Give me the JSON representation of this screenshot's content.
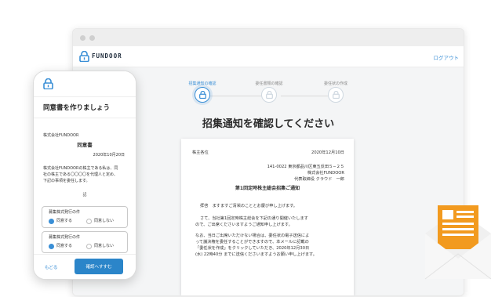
{
  "browser": {
    "app_name": "FUNDOOR",
    "logout_label": "ログアウト",
    "steps": [
      {
        "label": "招集通知の確認",
        "active": true
      },
      {
        "label": "委任書類の確認",
        "active": false
      },
      {
        "label": "委任状の作成",
        "active": false
      }
    ],
    "page_title": "招集通知を確認してください",
    "document": {
      "addressee": "株主各位",
      "date": "2020年12月10日",
      "sender_address": "141-0022 東京都品川区東五反田５−２５",
      "sender_company": "株式会社FUNDOOR",
      "sender_rep": "代表取締役 クラウド　一郎",
      "heading": "第1回定時株主総会招集ご通知",
      "greeting": "拝啓　ますますご清栄のこととお慶び申し上げます。",
      "para1_line1": "さて、当社第1回定時株主総会を下記の通り開催いたします",
      "para1_line2": "ので、ご出席くださいますようご通知申し上げます。",
      "para2_line1": "なお、当日ご出席いただけない場合は、委任状の電子送信によ",
      "para2_line2": "って議決権を委任することができますので、本メールに記載の",
      "para2_line3": "「委任状を作成」をクリックしていただき、2020年12月30日",
      "para2_line4": "(水) 22時40分 までに送信くださいますようお願い申し上げます。"
    }
  },
  "phone": {
    "title": "同意書を作りましょう",
    "company": "株式会社FUNDOOR",
    "doc_title": "同意書",
    "date": "2020年10月20日",
    "body_line1": "株式会社FUNDOORの株主である私は、同",
    "body_line2": "社の株主である〇〇〇〇を代理人と定め、",
    "body_line3": "下記の事項を委任します。",
    "ki": "記",
    "items": [
      {
        "label": "募集株式発行の件",
        "agree": "同意する",
        "disagree": "同意しない"
      },
      {
        "label": "募集株式発行の件",
        "agree": "同意する",
        "disagree": "同意しない"
      }
    ],
    "back_label": "もどる",
    "confirm_label": "確認へすすむ"
  },
  "colors": {
    "accent": "#3a8fd6",
    "button": "#2b85c9",
    "envelope_orange": "#f29a1f"
  },
  "icons": [
    "lock-logo-icon",
    "document-icon",
    "envelope-icon"
  ]
}
